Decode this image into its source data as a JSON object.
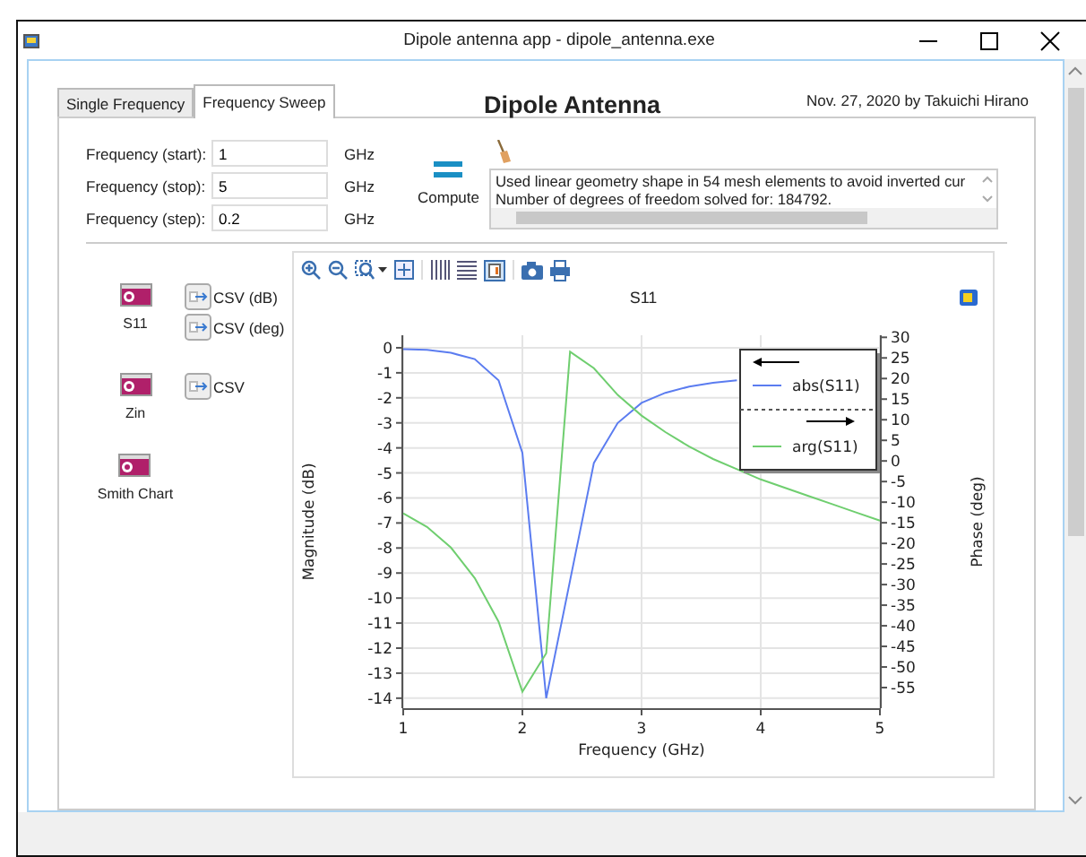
{
  "window": {
    "title": "Dipole antenna app - dipole_antenna.exe"
  },
  "tabs": [
    {
      "label": "Single Frequency",
      "selected": false
    },
    {
      "label": "Frequency Sweep",
      "selected": true
    }
  ],
  "heading": "Dipole Antenna",
  "credit": "Nov. 27, 2020 by Takuichi Hirano",
  "inputs": [
    {
      "label": "Frequency (start):",
      "value": "1",
      "unit": "GHz"
    },
    {
      "label": "Frequency (stop):",
      "value": "5",
      "unit": "GHz"
    },
    {
      "label": "Frequency (step):",
      "value": "0.2",
      "unit": "GHz"
    }
  ],
  "compute_button": {
    "label": "Compute"
  },
  "message_log": {
    "lines": [
      "Used linear geometry shape in 54 mesh elements to avoid inverted cur",
      "Number of degrees of freedom solved for: 184792."
    ]
  },
  "result_buttons": [
    {
      "label": "S11",
      "exports": [
        "CSV (dB)",
        "CSV (deg)"
      ]
    },
    {
      "label": "Zin",
      "exports": [
        "CSV"
      ]
    },
    {
      "label": "Smith Chart"
    }
  ],
  "plot": {
    "chart_data": {
      "type": "line",
      "title": "S11",
      "xlabel": "Frequency (GHz)",
      "ylabel": "Magnitude (dB)",
      "y2label": "Phase (deg)",
      "x": [
        1,
        1.2,
        1.4,
        1.6,
        1.8,
        2,
        2.2,
        2.4,
        2.6,
        2.8,
        3,
        3.2,
        3.4,
        3.6,
        3.8,
        4,
        4.2,
        4.4,
        4.6,
        4.8,
        5
      ],
      "series": [
        {
          "name": "abs(S11)",
          "color": "#5b7cf0",
          "values": [
            -0.05,
            -0.08,
            -0.2,
            -0.45,
            -1.3,
            -4.2,
            -14,
            -9.3,
            -4.6,
            -3,
            -2.2,
            -1.8,
            -1.55,
            -1.4,
            -1.3,
            null,
            null,
            null,
            null,
            null,
            null
          ]
        },
        {
          "name": "arg(S11)",
          "color": "#6fce6f",
          "axis": "y2",
          "values": [
            -12.7,
            -16,
            -21,
            -28.4,
            -39,
            -56,
            -46.7,
            26.5,
            22.5,
            16,
            11,
            7,
            3.5,
            0.5,
            -2,
            -4.5,
            -6.5,
            -8.5,
            -10.5,
            -12.5,
            -14.5
          ]
        }
      ],
      "grid": true,
      "legend": true,
      "xlim": [
        1,
        5
      ],
      "ylim": [
        -14.4,
        0.5
      ],
      "y2lim": [
        -60,
        30.5
      ],
      "xticks": [
        1,
        2,
        3,
        4,
        5
      ],
      "yticks": [
        0,
        -1,
        -2,
        -3,
        -4,
        -5,
        -6,
        -7,
        -8,
        -9,
        -10,
        -11,
        -12,
        -13,
        -14
      ],
      "y2ticks": [
        30,
        25,
        20,
        15,
        10,
        5,
        0,
        -5,
        -10,
        -15,
        -20,
        -25,
        -30,
        -35,
        -40,
        -45,
        -50,
        -55
      ]
    }
  }
}
